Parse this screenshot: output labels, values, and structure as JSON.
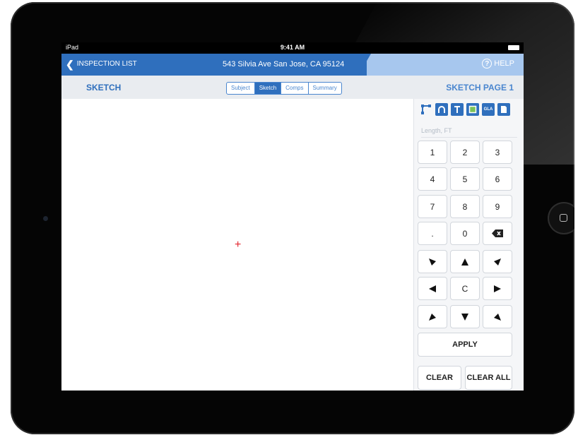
{
  "status_bar": {
    "carrier": "iPad",
    "time": "9:41 AM"
  },
  "nav": {
    "back_label": "INSPECTION LIST",
    "address": "543 Silvia Ave San Jose, CA 95124",
    "help_label": "HELP"
  },
  "subbar": {
    "title": "SKETCH",
    "page": "SKETCH PAGE 1",
    "tabs": [
      "Subject",
      "Sketch",
      "Comps",
      "Summary"
    ],
    "active_tab": "Sketch"
  },
  "tools": [
    "line-icon",
    "arc-icon",
    "text-icon",
    "area-icon",
    "gla-icon",
    "page-icon"
  ],
  "tool_gla_label": "GLA",
  "length_placeholder": "Length, FT",
  "keypad": {
    "rows": [
      [
        "1",
        "2",
        "3"
      ],
      [
        "4",
        "5",
        "6"
      ],
      [
        "7",
        "8",
        "9"
      ],
      [
        ".",
        "0",
        "backspace-icon"
      ]
    ],
    "arrows": [
      [
        "diag-down-right",
        "up",
        "diag-down-left"
      ],
      [
        "left",
        "C",
        "right"
      ],
      [
        "diag-up-right",
        "down",
        "diag-up-left"
      ]
    ],
    "apply": "APPLY",
    "clear": "CLEAR",
    "clear_all": "CLEAR ALL"
  },
  "colors": {
    "brand_blue": "#2f6fbd",
    "nav_light": "#a7c7ee",
    "cursor_red": "#e3262e"
  }
}
